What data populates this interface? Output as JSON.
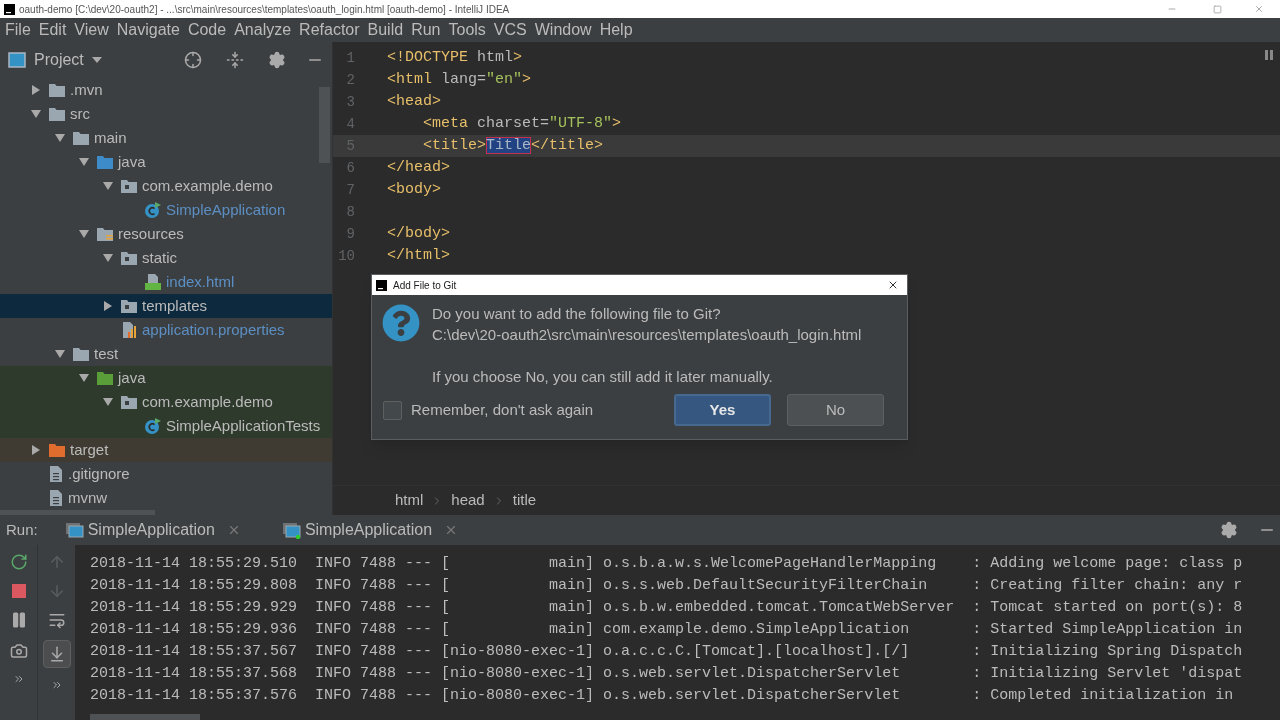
{
  "window": {
    "title": "oauth-demo [C:\\dev\\20-oauth2] - ...\\src\\main\\resources\\templates\\oauth_login.html [oauth-demo] - IntelliJ IDEA"
  },
  "menu": [
    "File",
    "Edit",
    "View",
    "Navigate",
    "Code",
    "Analyze",
    "Refactor",
    "Build",
    "Run",
    "Tools",
    "VCS",
    "Window",
    "Help"
  ],
  "project_panel": {
    "title": "Project"
  },
  "tree": [
    {
      "label": ".mvn",
      "kind": "folder",
      "expanded": false,
      "selected": false,
      "changed": false
    },
    {
      "label": "src",
      "kind": "folder",
      "expanded": true,
      "selected": false,
      "changed": false,
      "children": [
        {
          "label": "main",
          "kind": "folder",
          "expanded": true,
          "selected": false,
          "changed": false,
          "children": [
            {
              "label": "java",
              "kind": "source-folder",
              "expanded": true,
              "selected": false,
              "changed": false,
              "children": [
                {
                  "label": "com.example.demo",
                  "kind": "package",
                  "expanded": true,
                  "selected": false,
                  "changed": false,
                  "children": [
                    {
                      "label": "SimpleApplication",
                      "kind": "class",
                      "selected": false,
                      "changed": true
                    }
                  ]
                }
              ]
            },
            {
              "label": "resources",
              "kind": "resources-folder",
              "expanded": true,
              "selected": false,
              "changed": false,
              "children": [
                {
                  "label": "static",
                  "kind": "package",
                  "expanded": true,
                  "selected": false,
                  "changed": false,
                  "children": [
                    {
                      "label": "index.html",
                      "kind": "html",
                      "selected": false,
                      "changed": true
                    }
                  ]
                },
                {
                  "label": "templates",
                  "kind": "package",
                  "expanded": false,
                  "selected": true,
                  "changed": false
                },
                {
                  "label": "application.properties",
                  "kind": "properties",
                  "selected": false,
                  "changed": true
                }
              ]
            }
          ]
        },
        {
          "label": "test",
          "kind": "folder",
          "expanded": true,
          "selected": false,
          "changed": false,
          "children": [
            {
              "label": "java",
              "kind": "test-folder",
              "expanded": true,
              "selected": false,
              "changed": false,
              "children": [
                {
                  "label": "com.example.demo",
                  "kind": "package",
                  "expanded": true,
                  "selected": false,
                  "changed": false,
                  "children": [
                    {
                      "label": "SimpleApplicationTests",
                      "kind": "class",
                      "selected": false,
                      "changed": false
                    }
                  ]
                }
              ]
            }
          ]
        }
      ]
    },
    {
      "label": "target",
      "kind": "excluded-folder",
      "expanded": false,
      "selected": false,
      "changed": false
    },
    {
      "label": ".gitignore",
      "kind": "file",
      "selected": false,
      "changed": false
    },
    {
      "label": "mvnw",
      "kind": "file",
      "selected": false,
      "changed": false
    }
  ],
  "editor": {
    "lines": [
      {
        "number": "1",
        "current": false,
        "segments": [
          {
            "text": "<!DOCTYPE ",
            "kind": "tag"
          },
          {
            "text": "html",
            "kind": "attr"
          },
          {
            "text": ">",
            "kind": "tag"
          }
        ]
      },
      {
        "number": "2",
        "current": false,
        "segments": [
          {
            "text": "<html ",
            "kind": "tag"
          },
          {
            "text": "lang=",
            "kind": "attr"
          },
          {
            "text": "\"en\"",
            "kind": "value"
          },
          {
            "text": ">",
            "kind": "tag"
          }
        ]
      },
      {
        "number": "3",
        "current": false,
        "segments": [
          {
            "text": "<head>",
            "kind": "tag"
          }
        ]
      },
      {
        "number": "4",
        "current": false,
        "segments": [
          {
            "text": "    <meta ",
            "kind": "tag"
          },
          {
            "text": "charset=",
            "kind": "attr"
          },
          {
            "text": "\"UTF-8\"",
            "kind": "value"
          },
          {
            "text": ">",
            "kind": "tag"
          }
        ]
      },
      {
        "number": "5",
        "current": true,
        "segments": [
          {
            "text": "    <title>",
            "kind": "tag"
          },
          {
            "text": "Title",
            "kind": "text",
            "selected": true
          },
          {
            "text": "</title>",
            "kind": "tag"
          }
        ]
      },
      {
        "number": "6",
        "current": false,
        "segments": [
          {
            "text": "</head>",
            "kind": "tag"
          }
        ]
      },
      {
        "number": "7",
        "current": false,
        "segments": [
          {
            "text": "<body>",
            "kind": "tag"
          }
        ]
      },
      {
        "number": "8",
        "current": false
      },
      {
        "number": "9",
        "current": false,
        "segments": [
          {
            "text": "</body>",
            "kind": "tag"
          }
        ]
      },
      {
        "number": "10",
        "current": false,
        "segments": [
          {
            "text": "</html>",
            "kind": "tag"
          }
        ]
      }
    ],
    "breadcrumbs": [
      "html",
      "head",
      "title"
    ]
  },
  "dialog": {
    "title": "Add File to Git",
    "question": "Do you want to add the following file to Git?",
    "path": "C:\\dev\\20-oauth2\\src\\main\\resources\\templates\\oauth_login.html",
    "note": "If you choose No, you can still add it later manually.",
    "checkbox": {
      "label": "Remember, don't ask again",
      "checked": false
    },
    "buttons": [
      {
        "label": "Yes",
        "default": true
      },
      {
        "label": "No",
        "default": false
      }
    ]
  },
  "run_panel": {
    "label": "Run:",
    "tabs": [
      {
        "label": "SimpleApplication",
        "running": false
      },
      {
        "label": "SimpleApplication",
        "running": true
      }
    ],
    "log": [
      "2018-11-14 18:55:29.510  INFO 7488 --- [           main] o.s.b.a.w.s.WelcomePageHandlerMapping    : Adding welcome page: class p",
      "2018-11-14 18:55:29.808  INFO 7488 --- [           main] o.s.s.web.DefaultSecurityFilterChain     : Creating filter chain: any r",
      "2018-11-14 18:55:29.929  INFO 7488 --- [           main] o.s.b.w.embedded.tomcat.TomcatWebServer  : Tomcat started on port(s): 8",
      "2018-11-14 18:55:29.936  INFO 7488 --- [           main] com.example.demo.SimpleApplication       : Started SimpleApplication in",
      "2018-11-14 18:55:37.567  INFO 7488 --- [nio-8080-exec-1] o.a.c.c.C.[Tomcat].[localhost].[/]       : Initializing Spring Dispatch",
      "2018-11-14 18:55:37.568  INFO 7488 --- [nio-8080-exec-1] o.s.web.servlet.DispatcherServlet        : Initializing Servlet 'dispat",
      "2018-11-14 18:55:37.576  INFO 7488 --- [nio-8080-exec-1] o.s.web.servlet.DispatcherServlet        : Completed initialization in"
    ]
  }
}
